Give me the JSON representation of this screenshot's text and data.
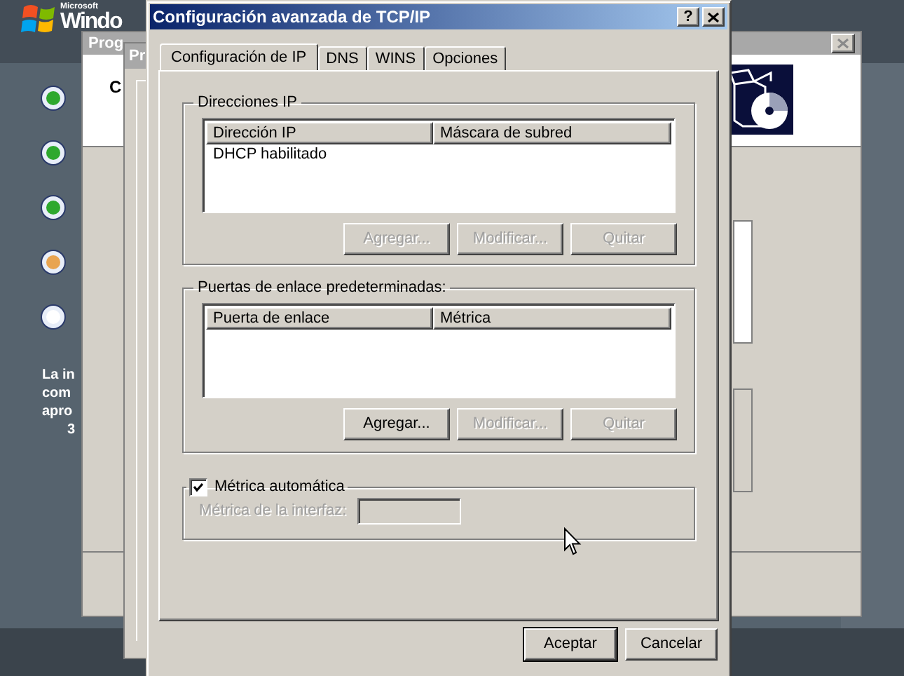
{
  "desktop": {
    "logo": {
      "small_text": "Microsoft",
      "text": "Windo"
    },
    "steps": [
      {
        "color": "#2ea82e"
      },
      {
        "color": "#2ea82e"
      },
      {
        "color": "#2ea82e"
      },
      {
        "color": "#e8a450"
      },
      {
        "color": "#ffffff"
      }
    ],
    "info_lines": [
      "La in",
      "com",
      "apro",
      "3"
    ]
  },
  "background_windows": [
    {
      "title": "Prog",
      "text": "C"
    },
    {
      "title": "Pr"
    }
  ],
  "dialog": {
    "title": "Configuración avanzada de TCP/IP",
    "help_button": "?",
    "tabs": [
      {
        "label": "Configuración de IP",
        "selected": true
      },
      {
        "label": "DNS",
        "selected": false
      },
      {
        "label": "WINS",
        "selected": false
      },
      {
        "label": "Opciones",
        "selected": false
      }
    ],
    "ip_group": {
      "legend": "Direcciones IP",
      "columns": [
        "Dirección IP",
        "Máscara de subred"
      ],
      "rows": [
        [
          "DHCP habilitado"
        ]
      ],
      "buttons": [
        {
          "label": "Agregar...",
          "disabled": true
        },
        {
          "label": "Modificar...",
          "disabled": true
        },
        {
          "label": "Quitar",
          "disabled": true
        }
      ]
    },
    "gateway_group": {
      "legend": "Puertas de enlace predeterminadas:",
      "columns": [
        "Puerta de enlace",
        "Métrica"
      ],
      "buttons": [
        {
          "label": "Agregar...",
          "disabled": false
        },
        {
          "label": "Modificar...",
          "disabled": true
        },
        {
          "label": "Quitar",
          "disabled": true
        }
      ]
    },
    "metric_group": {
      "checkbox": {
        "label": "Métrica automática",
        "checked": true
      },
      "field": {
        "label": "Métrica de la interfaz:",
        "disabled": true
      }
    },
    "buttons": [
      {
        "label": "Aceptar",
        "default": true
      },
      {
        "label": "Cancelar",
        "default": false
      }
    ]
  }
}
